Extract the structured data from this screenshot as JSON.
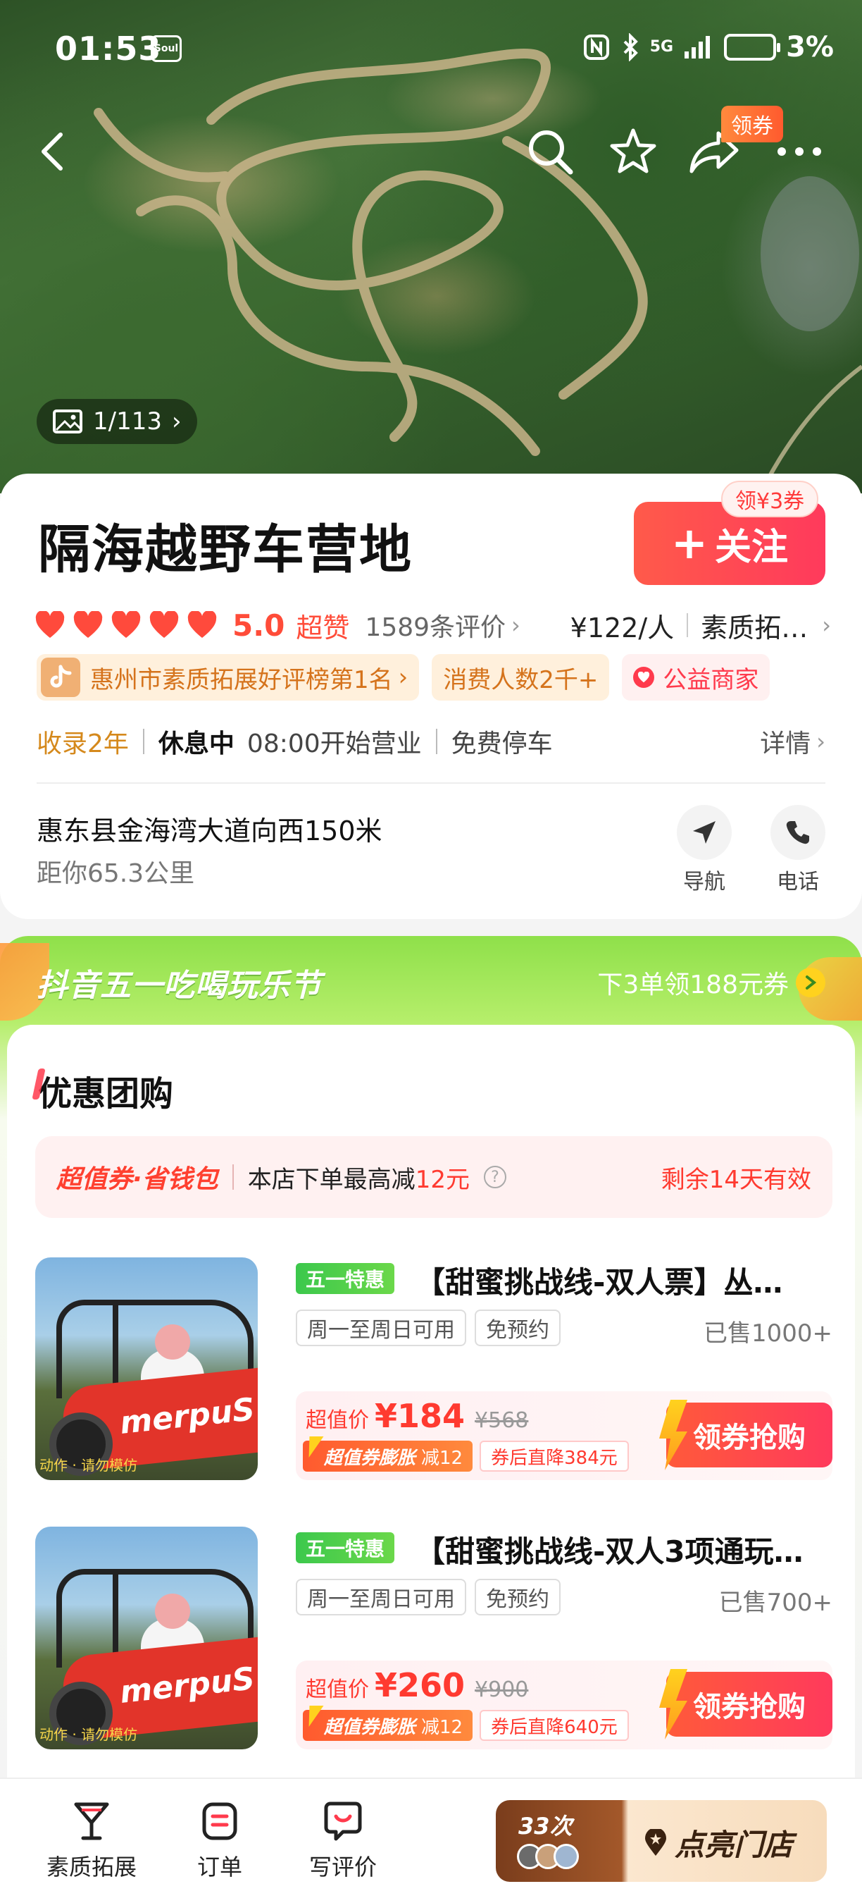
{
  "status_bar": {
    "time": "01:53",
    "soul_label": "Soul",
    "network": "5G",
    "battery": "3%"
  },
  "hero": {
    "coupon_tag": "领券",
    "photo_counter": "1/113"
  },
  "shop": {
    "name": "隔海越野车营地",
    "follow_label": "关注",
    "follow_coupon": "领¥3券",
    "rating": {
      "hearts": 5,
      "score": "5.0",
      "score_label": "超赞",
      "reviews": "1589条评价"
    },
    "price": "¥122/人",
    "category": "素质拓…",
    "tags": {
      "rank": "惠州市素质拓展好评榜第1名",
      "consumers": "消费人数2千+",
      "charity": "公益商家"
    },
    "info": {
      "collected": "收录2年",
      "status": "休息中",
      "hours": "08:00开始营业",
      "parking": "免费停车",
      "detail": "详情"
    },
    "address": "惠东县金海湾大道向西150米",
    "distance": "距你65.3公里",
    "actions": {
      "navigate": "导航",
      "phone": "电话"
    }
  },
  "festival": {
    "title": "抖音五一吃喝玩乐节",
    "promo": "下3单领188元券"
  },
  "deals": {
    "title": "优惠团购",
    "saver": {
      "brand": "超值券·省钱包",
      "text": "本店下单最高减",
      "amount": "12元",
      "valid": "剩余14天有效"
    },
    "items": [
      {
        "badge": "五一特惠",
        "title": "【甜蜜挑战线-双人票】丛…",
        "chips": [
          "周一至周日可用",
          "免预约"
        ],
        "sold": "已售1000+",
        "price_label": "超值价",
        "price": "¥184",
        "original": "¥568",
        "boost_label": "超值券膨胀",
        "boost_amount": "减12",
        "after": "券后直降384元",
        "buy_label": "领券抢购",
        "image_text": "merpuS",
        "image_caption": "动作 · 请勿模仿"
      },
      {
        "badge": "五一特惠",
        "title": "【甜蜜挑战线-双人3项通玩…",
        "chips": [
          "周一至周日可用",
          "免预约"
        ],
        "sold": "已售700+",
        "price_label": "超值价",
        "price": "¥260",
        "original": "¥900",
        "boost_label": "超值券膨胀",
        "boost_amount": "减12",
        "after": "券后直降640元",
        "buy_label": "领券抢购",
        "image_text": "merpuS",
        "image_caption": "动作 · 请勿模仿"
      }
    ]
  },
  "bottom_bar": {
    "tabs": [
      "素质拓展",
      "订单",
      "写评价"
    ],
    "light_up": {
      "count": "33次",
      "label": "点亮门店"
    }
  },
  "colors": {
    "accent": "#ff3a4c",
    "orange": "#d5731c",
    "festival_green": "#8fe04a"
  }
}
